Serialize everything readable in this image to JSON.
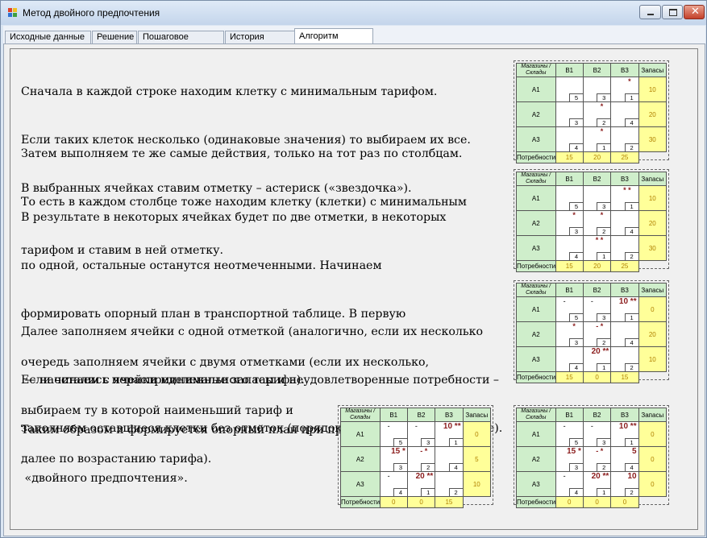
{
  "window": {
    "title": "Метод двойного предпочтения"
  },
  "tabs": [
    {
      "label": "Исходные данные"
    },
    {
      "label": "Решение"
    },
    {
      "label": "Пошаговое решение"
    },
    {
      "label": "История задачи"
    },
    {
      "label": "Алгоритм метода"
    }
  ],
  "text": {
    "p1": [
      "Сначала в каждой строке находим клетку с минимальным тарифом.",
      "Если таких клеток несколько (одинаковые значения) то выбираем их все.",
      "В выбранных ячейках ставим отметку – астериск («звездочка»)."
    ],
    "p2": [
      "Затем выполняем те же самые действия, только на тот раз по столбцам.",
      "То есть в каждом столбце тоже находим клетку (клетки) с минимальным",
      "тарифом и ставим в ней отметку."
    ],
    "p3": [
      "В результате в некоторых ячейках будет по две отметки, в некоторых",
      "по одной, остальные останутся неотмеченными. Начинаем",
      "формировать опорный план в транспортной таблице. В первую",
      "очередь заполняем ячейки с двумя отметками (если их несколько,",
      "выбираем ту в которой наименьший тариф и",
      "далее по возрастанию тарифа)."
    ],
    "p4": [
      "Далее заполняем ячейки с одной отметкой (аналогично, если их несколько",
      " — начинаем с ячейки минимального тарифа)."
    ],
    "p5": [
      "Если остались нераспределенные запасы и неудовлетворенные потребности –",
      "заполняем оставшиеся клетки без отметок (порядок их заполнения такой же)."
    ],
    "p6": [
      "Таким образом и формируется опорный план при применении метода",
      " «двойного предпочтения»."
    ]
  },
  "table_headers": {
    "corner": [
      "Магазины /",
      "Склады"
    ],
    "cols": [
      "B1",
      "B2",
      "B3"
    ],
    "supply": "Запасы",
    "rows": [
      "A1",
      "A2",
      "A3"
    ],
    "demand": "Потребности"
  },
  "tariffs": [
    [
      5,
      3,
      1
    ],
    [
      3,
      2,
      4
    ],
    [
      4,
      1,
      2
    ]
  ],
  "tables": [
    {
      "marks": [
        [
          "",
          "",
          "*"
        ],
        [
          "",
          "*",
          ""
        ],
        [
          "",
          "*",
          ""
        ]
      ],
      "allocs": [
        [
          "",
          "",
          ""
        ],
        [
          "",
          "",
          ""
        ],
        [
          "",
          "",
          ""
        ]
      ],
      "supply": [
        "10",
        "20",
        "30"
      ],
      "demand": [
        "15",
        "20",
        "25"
      ]
    },
    {
      "marks": [
        [
          "",
          "",
          "* *"
        ],
        [
          "*",
          "*",
          ""
        ],
        [
          "",
          "* *",
          ""
        ]
      ],
      "allocs": [
        [
          "",
          "",
          ""
        ],
        [
          "",
          "",
          ""
        ],
        [
          "",
          "",
          ""
        ]
      ],
      "supply": [
        "10",
        "20",
        "30"
      ],
      "demand": [
        "15",
        "20",
        "25"
      ]
    },
    {
      "marks": [
        [
          "-",
          "-",
          ""
        ],
        [
          "*",
          "- *",
          ""
        ],
        [
          "",
          "",
          ""
        ]
      ],
      "allocs": [
        [
          "",
          "",
          "10 **"
        ],
        [
          "",
          "",
          ""
        ],
        [
          "",
          "20 **",
          ""
        ]
      ],
      "supply": [
        "0",
        "20",
        "10"
      ],
      "demand": [
        "15",
        "0",
        "15"
      ]
    },
    {
      "marks": [
        [
          "-",
          "-",
          ""
        ],
        [
          "",
          "- *",
          ""
        ],
        [
          "-",
          "",
          ""
        ]
      ],
      "allocs": [
        [
          "",
          "",
          "10 **"
        ],
        [
          "15 *",
          "",
          ""
        ],
        [
          "",
          "20 **",
          ""
        ]
      ],
      "supply": [
        "0",
        "5",
        "10"
      ],
      "demand": [
        "0",
        "0",
        "15"
      ]
    },
    {
      "marks": [
        [
          "-",
          "-",
          ""
        ],
        [
          "",
          "- *",
          ""
        ],
        [
          "-",
          "",
          ""
        ]
      ],
      "allocs": [
        [
          "",
          "",
          "10 **"
        ],
        [
          "15 *",
          "",
          "5"
        ],
        [
          "",
          "20 **",
          "10"
        ]
      ],
      "supply": [
        "0",
        "0",
        "0"
      ],
      "demand": [
        "0",
        "0",
        "0"
      ]
    }
  ],
  "colors": {
    "header_green": "#cfeecb",
    "supply_yellow": "#ffff99",
    "alloc_red": "#8b1c1c"
  }
}
